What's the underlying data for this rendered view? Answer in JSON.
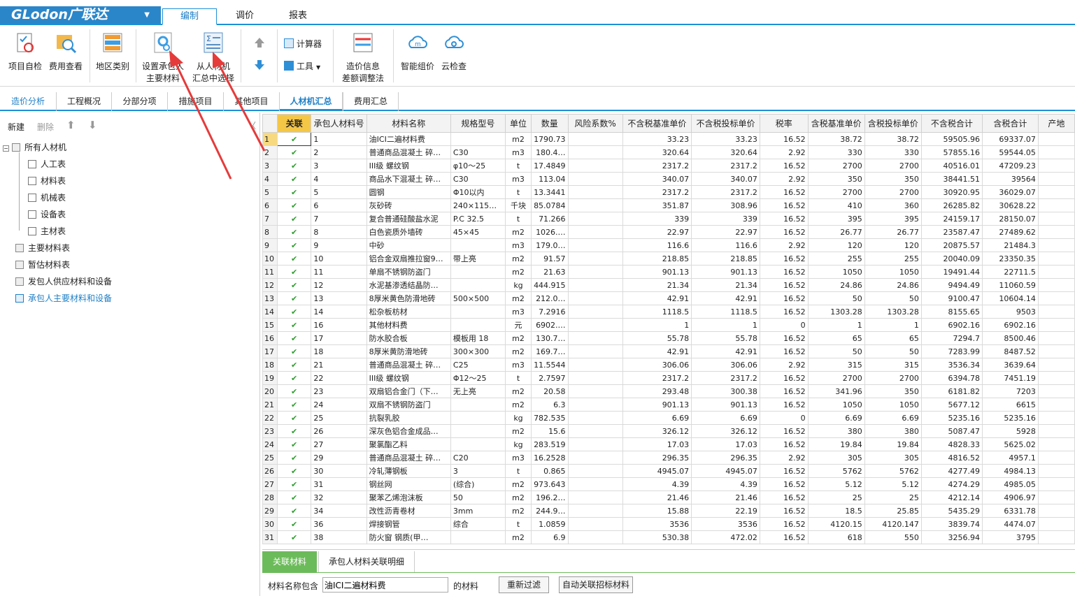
{
  "app": {
    "logo": "GLodon广联达",
    "caret": "▼"
  },
  "menu_tabs": [
    {
      "label": "编制"
    },
    {
      "label": "调价"
    },
    {
      "label": "报表"
    }
  ],
  "ribbon": {
    "buttons": [
      {
        "label": "项目自检",
        "icon": "check-list-icon"
      },
      {
        "label": "费用查看",
        "icon": "search-cost-icon"
      },
      {
        "label": "地区类别",
        "icon": "region-icon"
      },
      {
        "label1": "设置承包人",
        "label2": "主要材料",
        "icon": "gear-settings-icon"
      },
      {
        "label1": "从人材机",
        "label2": "汇总中选择",
        "icon": "sum-select-icon"
      },
      {
        "label": "计算器",
        "icon": "calculator-icon"
      },
      {
        "label": "工具",
        "icon": "tools-icon"
      },
      {
        "label1": "造价信息",
        "label2": "差额调整法",
        "icon": "price-info-icon"
      },
      {
        "label": "智能组价",
        "icon": "cloud-smart-icon"
      },
      {
        "label": "云检查",
        "icon": "cloud-check-icon"
      }
    ]
  },
  "sub_tabs": [
    {
      "label": "造价分析"
    },
    {
      "label": "工程概况"
    },
    {
      "label": "分部分项"
    },
    {
      "label": "措施项目"
    },
    {
      "label": "其他项目"
    },
    {
      "label": "人材机汇总"
    },
    {
      "label": "费用汇总"
    }
  ],
  "left_toolbar": {
    "new": "新建",
    "delete": "删除"
  },
  "tree": [
    {
      "label": "所有人材机"
    },
    {
      "label": "人工表"
    },
    {
      "label": "材料表"
    },
    {
      "label": "机械表"
    },
    {
      "label": "设备表"
    },
    {
      "label": "主材表"
    },
    {
      "label": "主要材料表"
    },
    {
      "label": "暂估材料表"
    },
    {
      "label": "发包人供应材料和设备"
    },
    {
      "label": "承包人主要材料和设备"
    }
  ],
  "columns": [
    "",
    "关联",
    "承包人材料号",
    "材料名称",
    "规格型号",
    "单位",
    "数量",
    "风险系数%",
    "不含税基准单价",
    "不含税投标单价",
    "税率",
    "含税基准单价",
    "含税投标单价",
    "不含税合计",
    "含税合计",
    "产地"
  ],
  "rows": [
    [
      "1",
      "✔",
      "1",
      "油ICI二遍材料费",
      "",
      "m2",
      "1790.73",
      "",
      "33.23",
      "33.23",
      "16.52",
      "38.72",
      "38.72",
      "59505.96",
      "69337.07"
    ],
    [
      "2",
      "✔",
      "2",
      "普通商品混凝土 碎…",
      "C30",
      "m3",
      "180.4…",
      "",
      "320.64",
      "320.64",
      "2.92",
      "330",
      "330",
      "57855.16",
      "59544.05"
    ],
    [
      "3",
      "✔",
      "3",
      "III级 螺纹钢",
      "φ10～25",
      "t",
      "17.4849",
      "",
      "2317.2",
      "2317.2",
      "16.52",
      "2700",
      "2700",
      "40516.01",
      "47209.23"
    ],
    [
      "4",
      "✔",
      "4",
      "商品水下混凝土 碎…",
      "C30",
      "m3",
      "113.04",
      "",
      "340.07",
      "340.07",
      "2.92",
      "350",
      "350",
      "38441.51",
      "39564"
    ],
    [
      "5",
      "✔",
      "5",
      "圆钢",
      "Φ10以内",
      "t",
      "13.3441",
      "",
      "2317.2",
      "2317.2",
      "16.52",
      "2700",
      "2700",
      "30920.95",
      "36029.07"
    ],
    [
      "6",
      "✔",
      "6",
      "灰砂砖",
      "240×115…",
      "千块",
      "85.0784",
      "",
      "351.87",
      "308.96",
      "16.52",
      "410",
      "360",
      "26285.82",
      "30628.22"
    ],
    [
      "7",
      "✔",
      "7",
      "复合普通硅酸盐水泥",
      "P.C 32.5",
      "t",
      "71.266",
      "",
      "339",
      "339",
      "16.52",
      "395",
      "395",
      "24159.17",
      "28150.07"
    ],
    [
      "8",
      "✔",
      "8",
      "白色瓷质外墙砖",
      "45×45",
      "m2",
      "1026.…",
      "",
      "22.97",
      "22.97",
      "16.52",
      "26.77",
      "26.77",
      "23587.47",
      "27489.62"
    ],
    [
      "9",
      "✔",
      "9",
      "中砂",
      "",
      "m3",
      "179.0…",
      "",
      "116.6",
      "116.6",
      "2.92",
      "120",
      "120",
      "20875.57",
      "21484.3"
    ],
    [
      "10",
      "✔",
      "10",
      "铝合金双扇推拉窗9…",
      "带上亮",
      "m2",
      "91.57",
      "",
      "218.85",
      "218.85",
      "16.52",
      "255",
      "255",
      "20040.09",
      "23350.35"
    ],
    [
      "11",
      "✔",
      "11",
      "单扇不锈钢防盗门",
      "",
      "m2",
      "21.63",
      "",
      "901.13",
      "901.13",
      "16.52",
      "1050",
      "1050",
      "19491.44",
      "22711.5"
    ],
    [
      "12",
      "✔",
      "12",
      "水泥基渗透结晶防…",
      "",
      "kg",
      "444.915",
      "",
      "21.34",
      "21.34",
      "16.52",
      "24.86",
      "24.86",
      "9494.49",
      "11060.59"
    ],
    [
      "13",
      "✔",
      "13",
      "8厚米黄色防滑地砖",
      "500×500",
      "m2",
      "212.0…",
      "",
      "42.91",
      "42.91",
      "16.52",
      "50",
      "50",
      "9100.47",
      "10604.14"
    ],
    [
      "14",
      "✔",
      "14",
      "松杂板枋材",
      "",
      "m3",
      "7.2916",
      "",
      "1118.5",
      "1118.5",
      "16.52",
      "1303.28",
      "1303.28",
      "8155.65",
      "9503"
    ],
    [
      "15",
      "✔",
      "16",
      "其他材料费",
      "",
      "元",
      "6902.…",
      "",
      "1",
      "1",
      "0",
      "1",
      "1",
      "6902.16",
      "6902.16"
    ],
    [
      "16",
      "✔",
      "17",
      "防水胶合板",
      "模板用 18",
      "m2",
      "130.7…",
      "",
      "55.78",
      "55.78",
      "16.52",
      "65",
      "65",
      "7294.7",
      "8500.46"
    ],
    [
      "17",
      "✔",
      "18",
      "8厚米黄防滑地砖",
      "300×300",
      "m2",
      "169.7…",
      "",
      "42.91",
      "42.91",
      "16.52",
      "50",
      "50",
      "7283.99",
      "8487.52"
    ],
    [
      "18",
      "✔",
      "21",
      "普通商品混凝土 碎…",
      "C25",
      "m3",
      "11.5544",
      "",
      "306.06",
      "306.06",
      "2.92",
      "315",
      "315",
      "3536.34",
      "3639.64"
    ],
    [
      "19",
      "✔",
      "22",
      "III级 螺纹钢",
      "Φ12～25",
      "t",
      "2.7597",
      "",
      "2317.2",
      "2317.2",
      "16.52",
      "2700",
      "2700",
      "6394.78",
      "7451.19"
    ],
    [
      "20",
      "✔",
      "23",
      "双扇铝合金门（下…",
      "无上亮",
      "m2",
      "20.58",
      "",
      "293.48",
      "300.38",
      "16.52",
      "341.96",
      "350",
      "6181.82",
      "7203"
    ],
    [
      "21",
      "✔",
      "24",
      "双扇不锈钢防盗门",
      "",
      "m2",
      "6.3",
      "",
      "901.13",
      "901.13",
      "16.52",
      "1050",
      "1050",
      "5677.12",
      "6615"
    ],
    [
      "22",
      "✔",
      "25",
      "抗裂乳胶",
      "",
      "kg",
      "782.535",
      "",
      "6.69",
      "6.69",
      "0",
      "6.69",
      "6.69",
      "5235.16",
      "5235.16"
    ],
    [
      "23",
      "✔",
      "26",
      "深灰色铝合金成品…",
      "",
      "m2",
      "15.6",
      "",
      "326.12",
      "326.12",
      "16.52",
      "380",
      "380",
      "5087.47",
      "5928"
    ],
    [
      "24",
      "✔",
      "27",
      "聚氯酯乙料",
      "",
      "kg",
      "283.519",
      "",
      "17.03",
      "17.03",
      "16.52",
      "19.84",
      "19.84",
      "4828.33",
      "5625.02"
    ],
    [
      "25",
      "✔",
      "29",
      "普通商品混凝土 碎…",
      "C20",
      "m3",
      "16.2528",
      "",
      "296.35",
      "296.35",
      "2.92",
      "305",
      "305",
      "4816.52",
      "4957.1"
    ],
    [
      "26",
      "✔",
      "30",
      "冷轧薄钢板",
      "3",
      "t",
      "0.865",
      "",
      "4945.07",
      "4945.07",
      "16.52",
      "5762",
      "5762",
      "4277.49",
      "4984.13"
    ],
    [
      "27",
      "✔",
      "31",
      "钢丝网",
      "(综合)",
      "m2",
      "973.643",
      "",
      "4.39",
      "4.39",
      "16.52",
      "5.12",
      "5.12",
      "4274.29",
      "4985.05"
    ],
    [
      "28",
      "✔",
      "32",
      "聚苯乙烯泡沫板",
      "50",
      "m2",
      "196.2…",
      "",
      "21.46",
      "21.46",
      "16.52",
      "25",
      "25",
      "4212.14",
      "4906.97"
    ],
    [
      "29",
      "✔",
      "34",
      "改性沥青卷材",
      "3mm",
      "m2",
      "244.9…",
      "",
      "15.88",
      "22.19",
      "16.52",
      "18.5",
      "25.85",
      "5435.29",
      "6331.78"
    ],
    [
      "30",
      "✔",
      "36",
      "焊接钢管",
      "综合",
      "t",
      "1.0859",
      "",
      "3536",
      "3536",
      "16.52",
      "4120.15",
      "4120.147",
      "3839.74",
      "4474.07"
    ],
    [
      "31",
      "✔",
      "38",
      "防火窗 钢质(甲…",
      "",
      "m2",
      "6.9",
      "",
      "530.38",
      "472.02",
      "16.52",
      "618",
      "550",
      "3256.94",
      "3795"
    ]
  ],
  "bottom": {
    "tab1": "关联材料",
    "tab2": "承包人材料关联明细",
    "filter_label": "材料名称包含",
    "filter_value": "油ICI二遍材料费",
    "suffix": "的材料",
    "refilter": "重新过滤",
    "auto_link": "自动关联招标材料"
  },
  "colors": {
    "accent": "#1e90d6",
    "check": "#2e9e2e",
    "selected_tab": "#6cbb5a",
    "arrow": "#e53b3b"
  }
}
